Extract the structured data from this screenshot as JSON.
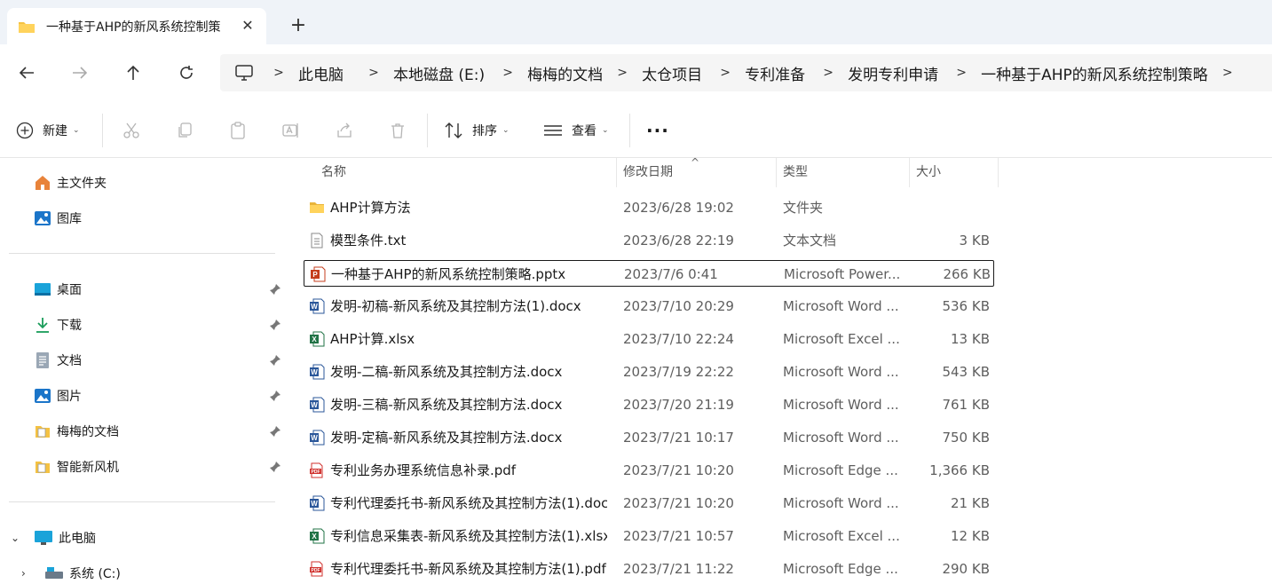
{
  "window": {
    "tab_title": "一种基于AHP的新风系统控制策略",
    "tab_title_visible": "一种基于AHP的新风系统控制策"
  },
  "breadcrumb": [
    "此电脑",
    "本地磁盘 (E:)",
    "梅梅的文档",
    "太仓项目",
    "专利准备",
    "发明专利申请",
    "一种基于AHP的新风系统控制策略"
  ],
  "toolbar": {
    "new_label": "新建",
    "sort_label": "排序",
    "view_label": "查看",
    "more_label": "···"
  },
  "sidebar": {
    "home": "主文件夹",
    "gallery": "图库",
    "quick": [
      {
        "label": "桌面",
        "icon": "desktop-icon"
      },
      {
        "label": "下载",
        "icon": "download-icon"
      },
      {
        "label": "文档",
        "icon": "document-icon"
      },
      {
        "label": "图片",
        "icon": "picture-icon"
      },
      {
        "label": "梅梅的文档",
        "icon": "folder-icon"
      },
      {
        "label": "智能新风机",
        "icon": "folder-icon"
      }
    ],
    "this_pc": "此电脑",
    "drive_c": "系统 (C:)"
  },
  "columns": {
    "name": "名称",
    "date": "修改日期",
    "type": "类型",
    "size": "大小"
  },
  "files": [
    {
      "name": "AHP计算方法",
      "date": "2023/6/28 19:02",
      "type": "文件夹",
      "size": "",
      "kind": "folder"
    },
    {
      "name": "模型条件.txt",
      "date": "2023/6/28 22:19",
      "type": "文本文档",
      "size": "3 KB",
      "kind": "txt"
    },
    {
      "name": "一种基于AHP的新风系统控制策略.pptx",
      "date": "2023/7/6 0:41",
      "type": "Microsoft Power...",
      "size": "266 KB",
      "kind": "pptx"
    },
    {
      "name": "发明-初稿-新风系统及其控制方法(1).docx",
      "date": "2023/7/10 20:29",
      "type": "Microsoft Word ...",
      "size": "536 KB",
      "kind": "docx"
    },
    {
      "name": "AHP计算.xlsx",
      "date": "2023/7/10 22:24",
      "type": "Microsoft Excel ...",
      "size": "13 KB",
      "kind": "xlsx"
    },
    {
      "name": "发明-二稿-新风系统及其控制方法.docx",
      "date": "2023/7/19 22:22",
      "type": "Microsoft Word ...",
      "size": "543 KB",
      "kind": "docx"
    },
    {
      "name": "发明-三稿-新风系统及其控制方法.docx",
      "date": "2023/7/20 21:19",
      "type": "Microsoft Word ...",
      "size": "761 KB",
      "kind": "docx"
    },
    {
      "name": "发明-定稿-新风系统及其控制方法.docx",
      "date": "2023/7/21 10:17",
      "type": "Microsoft Word ...",
      "size": "750 KB",
      "kind": "docx"
    },
    {
      "name": "专利业务办理系统信息补录.pdf",
      "date": "2023/7/21 10:20",
      "type": "Microsoft Edge ...",
      "size": "1,366 KB",
      "kind": "pdf"
    },
    {
      "name": "专利代理委托书-新风系统及其控制方法(1).doc",
      "date": "2023/7/21 10:20",
      "type": "Microsoft Word ...",
      "size": "21 KB",
      "kind": "doc"
    },
    {
      "name": "专利信息采集表-新风系统及其控制方法(1).xlsx",
      "date": "2023/7/21 10:57",
      "type": "Microsoft Excel ...",
      "size": "12 KB",
      "kind": "xlsx"
    },
    {
      "name": "专利代理委托书-新风系统及其控制方法(1).pdf",
      "date": "2023/7/21 11:22",
      "type": "Microsoft Edge ...",
      "size": "290 KB",
      "kind": "pdf"
    }
  ],
  "selected_index": 2,
  "colors": {
    "accent": "#0067c0",
    "word": "#2b579a",
    "excel": "#217346",
    "powerpoint": "#c43e1c",
    "pdf": "#d0312d",
    "folder": "#f5c242"
  }
}
